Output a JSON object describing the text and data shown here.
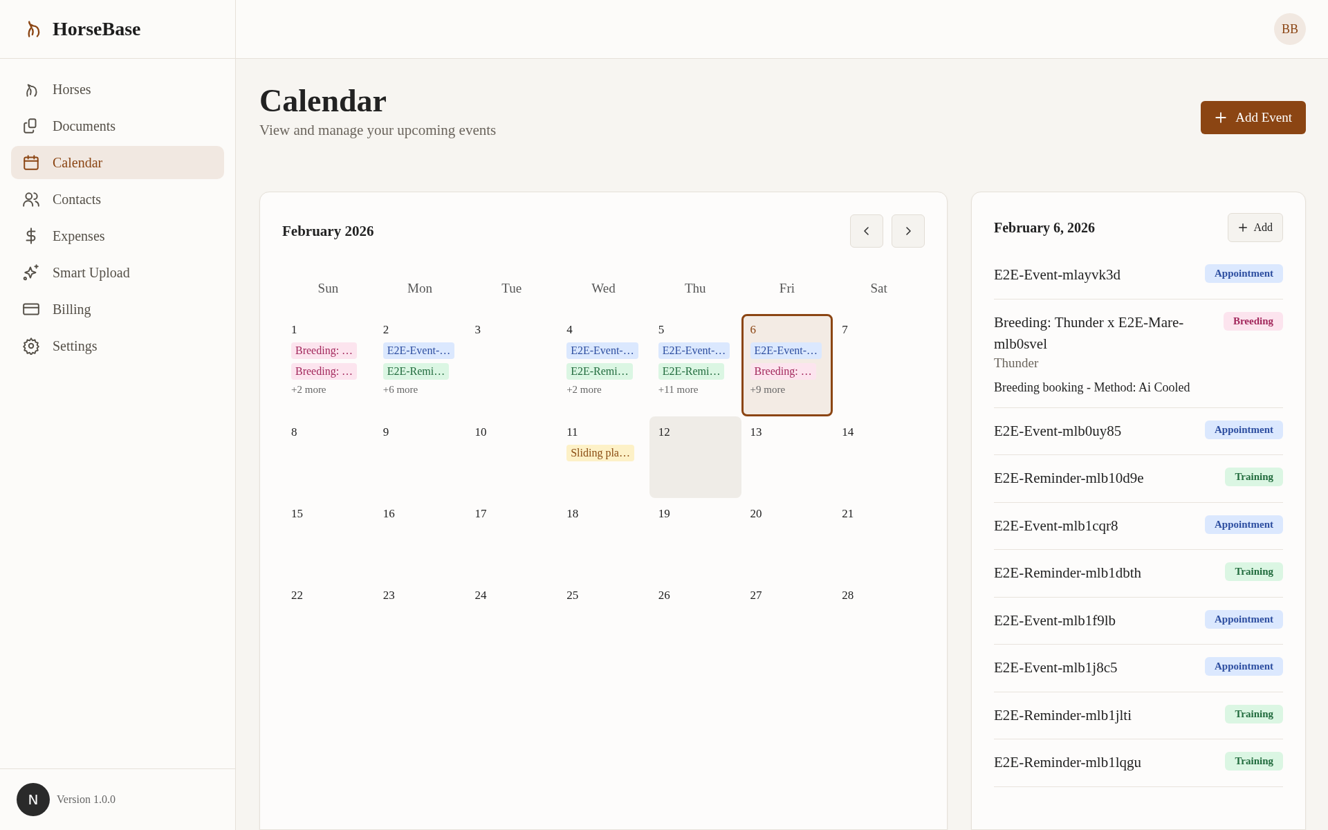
{
  "brand": {
    "name": "HorseBase"
  },
  "sidebar": {
    "items": [
      {
        "label": "Horses",
        "selected": false
      },
      {
        "label": "Documents",
        "selected": false
      },
      {
        "label": "Calendar",
        "selected": true
      },
      {
        "label": "Contacts",
        "selected": false
      },
      {
        "label": "Expenses",
        "selected": false
      },
      {
        "label": "Smart Upload",
        "selected": false
      },
      {
        "label": "Billing",
        "selected": false
      },
      {
        "label": "Settings",
        "selected": false
      }
    ],
    "version": "Version 1.0.0",
    "dev_badge": "N"
  },
  "user": {
    "initials": "BB"
  },
  "page": {
    "title": "Calendar",
    "subtitle": "View and manage your upcoming events",
    "add_button": "Add Event"
  },
  "calendar": {
    "month": "February 2026",
    "weekdays": [
      "Sun",
      "Mon",
      "Tue",
      "Wed",
      "Thu",
      "Fri",
      "Sat"
    ],
    "weeks": [
      [
        {
          "day": "1",
          "selected": false,
          "today": false,
          "events": [
            {
              "kind": "breeding",
              "label": "Breeding: …"
            },
            {
              "kind": "breeding",
              "label": "Breeding: …"
            }
          ],
          "more": "+2 more"
        },
        {
          "day": "2",
          "selected": false,
          "today": false,
          "events": [
            {
              "kind": "appointment",
              "label": "E2E-Event-…"
            },
            {
              "kind": "training",
              "label": "E2E-Remi…"
            }
          ],
          "more": "+6 more"
        },
        {
          "day": "3",
          "selected": false,
          "today": false
        },
        {
          "day": "4",
          "selected": false,
          "today": false,
          "events": [
            {
              "kind": "appointment",
              "label": "E2E-Event-…"
            },
            {
              "kind": "training",
              "label": "E2E-Remi…"
            }
          ],
          "more": "+2 more"
        },
        {
          "day": "5",
          "selected": false,
          "today": false,
          "events": [
            {
              "kind": "appointment",
              "label": "E2E-Event-…"
            },
            {
              "kind": "training",
              "label": "E2E-Remi…"
            }
          ],
          "more": "+11 more"
        },
        {
          "day": "6",
          "selected": true,
          "today": false,
          "events": [
            {
              "kind": "appointment",
              "label": "E2E-Event-…"
            },
            {
              "kind": "breeding",
              "label": "Breeding: …"
            }
          ],
          "more": "+9 more"
        },
        {
          "day": "7",
          "selected": false,
          "today": false
        }
      ],
      [
        {
          "day": "8",
          "selected": false,
          "today": false
        },
        {
          "day": "9",
          "selected": false,
          "today": false
        },
        {
          "day": "10",
          "selected": false,
          "today": false
        },
        {
          "day": "11",
          "selected": false,
          "today": false,
          "events": [
            {
              "kind": "other",
              "label": "Sliding pla…"
            }
          ]
        },
        {
          "day": "12",
          "selected": false,
          "today": true
        },
        {
          "day": "13",
          "selected": false,
          "today": false
        },
        {
          "day": "14",
          "selected": false,
          "today": false
        }
      ],
      [
        {
          "day": "15",
          "selected": false,
          "today": false
        },
        {
          "day": "16",
          "selected": false,
          "today": false
        },
        {
          "day": "17",
          "selected": false,
          "today": false
        },
        {
          "day": "18",
          "selected": false,
          "today": false
        },
        {
          "day": "19",
          "selected": false,
          "today": false
        },
        {
          "day": "20",
          "selected": false,
          "today": false
        },
        {
          "day": "21",
          "selected": false,
          "today": false
        }
      ],
      [
        {
          "day": "22",
          "selected": false,
          "today": false
        },
        {
          "day": "23",
          "selected": false,
          "today": false
        },
        {
          "day": "24",
          "selected": false,
          "today": false
        },
        {
          "day": "25",
          "selected": false,
          "today": false
        },
        {
          "day": "26",
          "selected": false,
          "today": false
        },
        {
          "day": "27",
          "selected": false,
          "today": false
        },
        {
          "day": "28",
          "selected": false,
          "today": false
        }
      ]
    ]
  },
  "day_panel": {
    "date": "February 6, 2026",
    "add_button": "Add",
    "events": [
      {
        "title": "E2E-Event-mlayvk3d",
        "kind": "appointment",
        "tag": "Appointment"
      },
      {
        "title": "Breeding: Thunder x E2E-Mare-mlb0svel",
        "subtitle": "Thunder",
        "description": "Breeding booking - Method: Ai Cooled",
        "kind": "breeding",
        "tag": "Breeding"
      },
      {
        "title": "E2E-Event-mlb0uy85",
        "kind": "appointment",
        "tag": "Appointment"
      },
      {
        "title": "E2E-Reminder-mlb10d9e",
        "kind": "training",
        "tag": "Training"
      },
      {
        "title": "E2E-Event-mlb1cqr8",
        "kind": "appointment",
        "tag": "Appointment"
      },
      {
        "title": "E2E-Reminder-mlb1dbth",
        "kind": "training",
        "tag": "Training"
      },
      {
        "title": "E2E-Event-mlb1f9lb",
        "kind": "appointment",
        "tag": "Appointment"
      },
      {
        "title": "E2E-Event-mlb1j8c5",
        "kind": "appointment",
        "tag": "Appointment"
      },
      {
        "title": "E2E-Reminder-mlb1jlti",
        "kind": "training",
        "tag": "Training"
      },
      {
        "title": "E2E-Reminder-mlb1lqgu",
        "kind": "training",
        "tag": "Training"
      }
    ]
  }
}
